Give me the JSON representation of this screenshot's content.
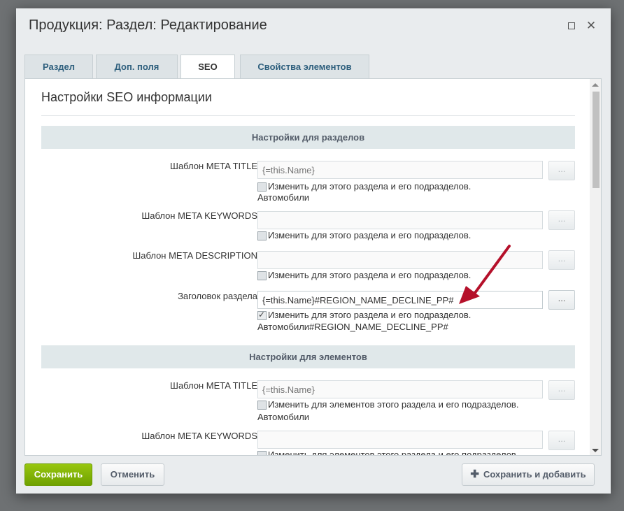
{
  "window": {
    "title": "Продукция: Раздел: Редактирование",
    "maximize_icon": "maximize-icon",
    "close_icon": "close-icon"
  },
  "tabs": [
    {
      "label": "Раздел",
      "active": false
    },
    {
      "label": "Доп. поля",
      "active": false
    },
    {
      "label": "SEO",
      "active": true
    },
    {
      "label": "Свойства элементов",
      "active": false
    }
  ],
  "content": {
    "heading": "Настройки SEO информации",
    "sections": [
      {
        "title": "Настройки для разделов",
        "fields": [
          {
            "label": "Шаблон META TITLE",
            "value": "",
            "placeholder": "{=this.Name}",
            "disabled": true,
            "checkbox": "Изменить для этого раздела и его подразделов.",
            "checked": false,
            "hint": "Автомобили"
          },
          {
            "label": "Шаблон META KEYWORDS",
            "value": "",
            "placeholder": "",
            "disabled": true,
            "checkbox": "Изменить для этого раздела и его подразделов.",
            "checked": false,
            "hint": ""
          },
          {
            "label": "Шаблон META DESCRIPTION",
            "value": "",
            "placeholder": "",
            "disabled": true,
            "checkbox": "Изменить для этого раздела и его подразделов.",
            "checked": false,
            "hint": ""
          },
          {
            "label": "Заголовок раздела",
            "value": "{=this.Name}#REGION_NAME_DECLINE_PP#",
            "placeholder": "",
            "disabled": false,
            "checkbox": "Изменить для этого раздела и его подразделов.",
            "checked": true,
            "hint": "Автомобили#REGION_NAME_DECLINE_PP#"
          }
        ]
      },
      {
        "title": "Настройки для элементов",
        "fields": [
          {
            "label": "Шаблон META TITLE",
            "value": "",
            "placeholder": "{=this.Name}",
            "disabled": true,
            "checkbox": "Изменить для элементов этого раздела и его подразделов.",
            "checked": false,
            "hint": "Автомобили"
          },
          {
            "label": "Шаблон META KEYWORDS",
            "value": "",
            "placeholder": "",
            "disabled": true,
            "checkbox": "Изменить для элементов этого раздела и его подразделов.",
            "checked": false,
            "hint": ""
          }
        ]
      }
    ],
    "dots_label": "..."
  },
  "footer": {
    "save_label": "Сохранить",
    "cancel_label": "Отменить",
    "save_add_label": "Сохранить и добавить",
    "save_add_icon": "plus-icon"
  },
  "colors": {
    "accent_green": "#7bb300",
    "annotation_arrow": "#b5102a",
    "section_bg": "#e0e8ea"
  }
}
